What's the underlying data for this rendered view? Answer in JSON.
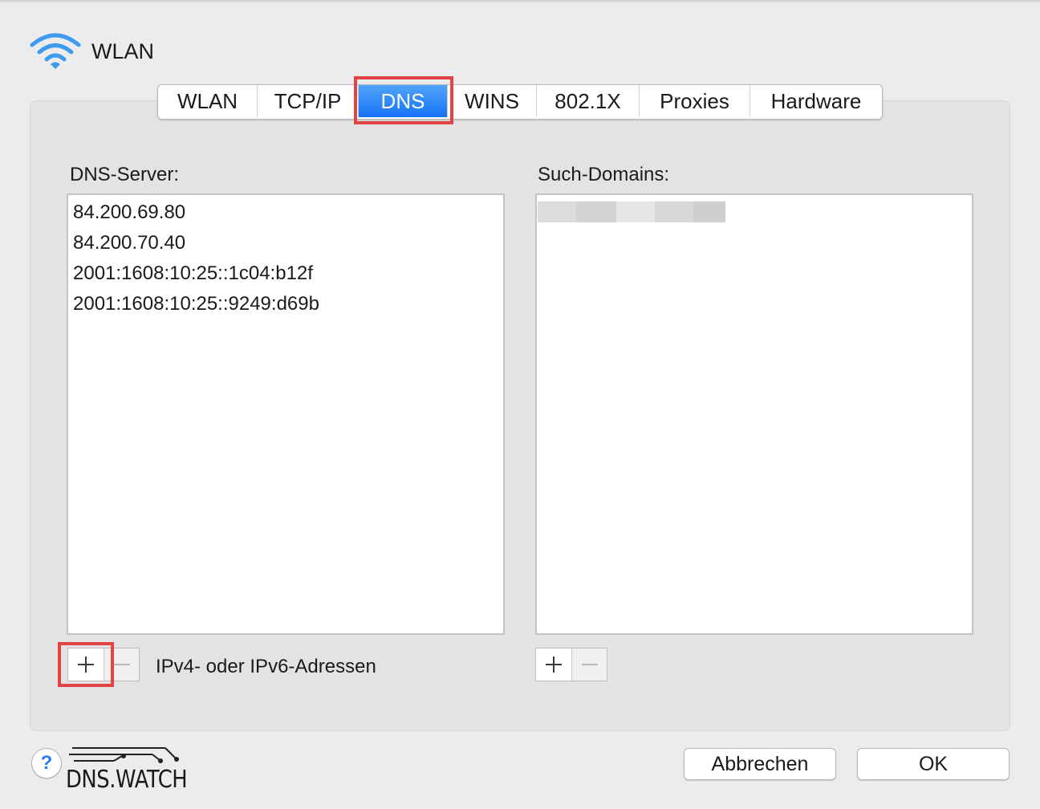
{
  "window": {
    "title": "WLAN"
  },
  "tabs": [
    {
      "label": "WLAN",
      "active": false
    },
    {
      "label": "TCP/IP",
      "active": false
    },
    {
      "label": "DNS",
      "active": true
    },
    {
      "label": "WINS",
      "active": false
    },
    {
      "label": "802.1X",
      "active": false
    },
    {
      "label": "Proxies",
      "active": false
    },
    {
      "label": "Hardware",
      "active": false
    }
  ],
  "dns": {
    "servers_label": "DNS-Server:",
    "servers": [
      "84.200.69.80",
      "84.200.70.40",
      "2001:1608:10:25::1c04:b12f",
      "2001:1608:10:25::9249:d69b"
    ],
    "hint": "IPv4- oder IPv6-Adressen",
    "search_label": "Such-Domains:"
  },
  "footer": {
    "help": "?",
    "logo_text": "DNS.WATCH",
    "cancel": "Abbrechen",
    "ok": "OK"
  },
  "colors": {
    "accent": "#1573f5",
    "highlight": "#e04444"
  }
}
